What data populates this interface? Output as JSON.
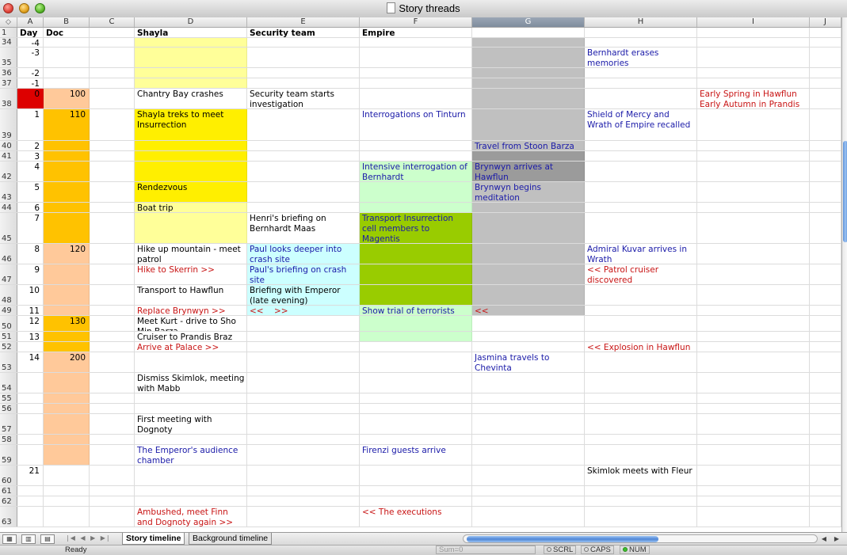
{
  "window": {
    "title": "Story threads"
  },
  "columns": [
    "A",
    "B",
    "C",
    "D",
    "E",
    "F",
    "G",
    "H",
    "I",
    "J"
  ],
  "selected_column": "G",
  "header_row": {
    "num": "1",
    "A": "Day",
    "B": "Doc",
    "D": "Shayla",
    "E": "Security team",
    "F": "Empire"
  },
  "rows": [
    {
      "num": "34",
      "A": "-4",
      "B": "",
      "D": "",
      "E": "",
      "F": "",
      "G": "",
      "H": "",
      "I": ""
    },
    {
      "num": "35",
      "A": "-3",
      "B": "",
      "D": "",
      "E": "",
      "F": "",
      "G": "",
      "H": "Bernhardt erases memories",
      "I": ""
    },
    {
      "num": "36",
      "A": "-2",
      "B": "",
      "D": "",
      "E": "",
      "F": "",
      "G": "",
      "H": "",
      "I": ""
    },
    {
      "num": "37",
      "A": "-1",
      "B": "",
      "D": "",
      "E": "",
      "F": "",
      "G": "",
      "H": "",
      "I": ""
    },
    {
      "num": "38",
      "A": "0",
      "B": "100",
      "D": "Chantry Bay crashes",
      "E": "Security team starts investigation",
      "F": "",
      "G": "",
      "H": "",
      "I": "Early Spring in Hawflun\nEarly Autumn in Prandis"
    },
    {
      "num": "39",
      "A": "1",
      "B": "110",
      "D": "Shayla treks to meet Insurrection",
      "E": "",
      "F": "Interrogations on Tinturn",
      "G": "",
      "H": "Shield of Mercy and Wrath of Empire recalled",
      "I": ""
    },
    {
      "num": "40",
      "A": "2",
      "B": "",
      "D": "",
      "E": "",
      "F": "",
      "G": "Travel from Stoon Barza",
      "H": "",
      "I": ""
    },
    {
      "num": "41",
      "A": "3",
      "B": "",
      "D": "",
      "E": "",
      "F": "",
      "G": "",
      "H": "",
      "I": ""
    },
    {
      "num": "42",
      "A": "4",
      "B": "",
      "D": "",
      "E": "",
      "F": "Intensive interrogation of Bernhardt",
      "G": "Brynwyn arrives at Hawflun",
      "H": "",
      "I": ""
    },
    {
      "num": "43",
      "A": "5",
      "B": "",
      "D": "Rendezvous",
      "E": "",
      "F": "",
      "G": "Brynwyn begins meditation",
      "H": "",
      "I": ""
    },
    {
      "num": "44",
      "A": "6",
      "B": "",
      "D": "Boat trip",
      "E": "",
      "F": "",
      "G": "",
      "H": "",
      "I": ""
    },
    {
      "num": "45",
      "A": "7",
      "B": "",
      "D": "",
      "E": "Henri's briefing on Bernhardt Maas",
      "F": "Transport Insurrection cell members to Magentis",
      "G": "",
      "H": "",
      "I": ""
    },
    {
      "num": "46",
      "A": "8",
      "B": "120",
      "D": "Hike up mountain - meet patrol",
      "E": "Paul looks deeper into crash site",
      "F": "",
      "G": "",
      "H": "Admiral Kuvar arrives in Wrath",
      "I": ""
    },
    {
      "num": "47",
      "A": "9",
      "B": "",
      "D": "Hike to Skerrin >>",
      "E": "Paul's briefing on crash site",
      "F": "",
      "G": "",
      "H": "<< Patrol cruiser discovered",
      "I": ""
    },
    {
      "num": "48",
      "A": "10",
      "B": "",
      "D": "Transport to Hawflun",
      "E": "Briefing with Emperor (late evening)",
      "F": "",
      "G": "",
      "H": "",
      "I": ""
    },
    {
      "num": "49",
      "A": "11",
      "B": "",
      "D": "Replace Brynwyn >>",
      "E": "<<    >>",
      "F": "Show trial of terrorists",
      "G": "<<",
      "H": "",
      "I": ""
    },
    {
      "num": "50",
      "A": "12",
      "B": "130",
      "D": "Meet Kurt - drive to Sho Min Barza",
      "E": "",
      "F": "",
      "G": "",
      "H": "",
      "I": ""
    },
    {
      "num": "51",
      "A": "13",
      "B": "",
      "D": "Cruiser to Prandis Braz",
      "E": "",
      "F": "",
      "G": "",
      "H": "",
      "I": ""
    },
    {
      "num": "52",
      "A": "",
      "B": "",
      "D": "Arrive at Palace >>",
      "E": "",
      "F": "",
      "G": "",
      "H": "<< Explosion in Hawflun",
      "I": ""
    },
    {
      "num": "53",
      "A": "14",
      "B": "200",
      "D": "",
      "E": "",
      "F": "",
      "G": "Jasmina travels to Chevinta",
      "H": "",
      "I": ""
    },
    {
      "num": "54",
      "A": "",
      "B": "",
      "D": "Dismiss Skimlok, meeting with Mabb",
      "E": "",
      "F": "",
      "G": "",
      "H": "",
      "I": ""
    },
    {
      "num": "55",
      "A": "",
      "B": "",
      "D": "",
      "E": "",
      "F": "",
      "G": "",
      "H": "",
      "I": ""
    },
    {
      "num": "56",
      "A": "",
      "B": "",
      "D": "",
      "E": "",
      "F": "",
      "G": "",
      "H": "",
      "I": ""
    },
    {
      "num": "57",
      "A": "",
      "B": "",
      "D": "First meeting with Dognoty",
      "E": "",
      "F": "",
      "G": "",
      "H": "",
      "I": ""
    },
    {
      "num": "58",
      "A": "",
      "B": "",
      "D": "",
      "E": "",
      "F": "",
      "G": "",
      "H": "",
      "I": ""
    },
    {
      "num": "59",
      "A": "",
      "B": "",
      "D": "The Emperor's audience chamber",
      "E": "",
      "F": "Firenzi guests arrive",
      "G": "",
      "H": "",
      "I": ""
    },
    {
      "num": "60",
      "A": "21",
      "B": "",
      "D": "",
      "E": "",
      "F": "",
      "G": "",
      "H": "Skimlok meets with Fleur",
      "I": ""
    },
    {
      "num": "61",
      "A": "",
      "B": "",
      "D": "",
      "E": "",
      "F": "",
      "G": "",
      "H": "",
      "I": ""
    },
    {
      "num": "62",
      "A": "",
      "B": "",
      "D": "",
      "E": "",
      "F": "",
      "G": "",
      "H": "",
      "I": ""
    },
    {
      "num": "63",
      "A": "",
      "B": "",
      "D": "Ambushed, meet Finn and Dognoty again >>",
      "E": "",
      "F": "<< The executions",
      "G": "",
      "H": "",
      "I": ""
    }
  ],
  "colors": {
    "yellow_light": "#ffff99",
    "yellow": "#ffef00",
    "red": "#dd0000",
    "peach": "#ffc99a",
    "orange": "#ffc200",
    "gray": "#c0c0c0",
    "gray_dark": "#9b9b9b",
    "green_light": "#ccffcc",
    "green": "#99cc00",
    "cyan": "#ccffff",
    "text_blue": "#1a1aa8",
    "text_red": "#c81414"
  },
  "sheet_tabs": [
    "Story timeline",
    "Background timeline"
  ],
  "active_tab": "Story timeline",
  "status": {
    "text": "Ready",
    "sum": "Sum=0",
    "indicators": [
      "SCRL",
      "CAPS",
      "NUM"
    ],
    "num_on": true
  }
}
